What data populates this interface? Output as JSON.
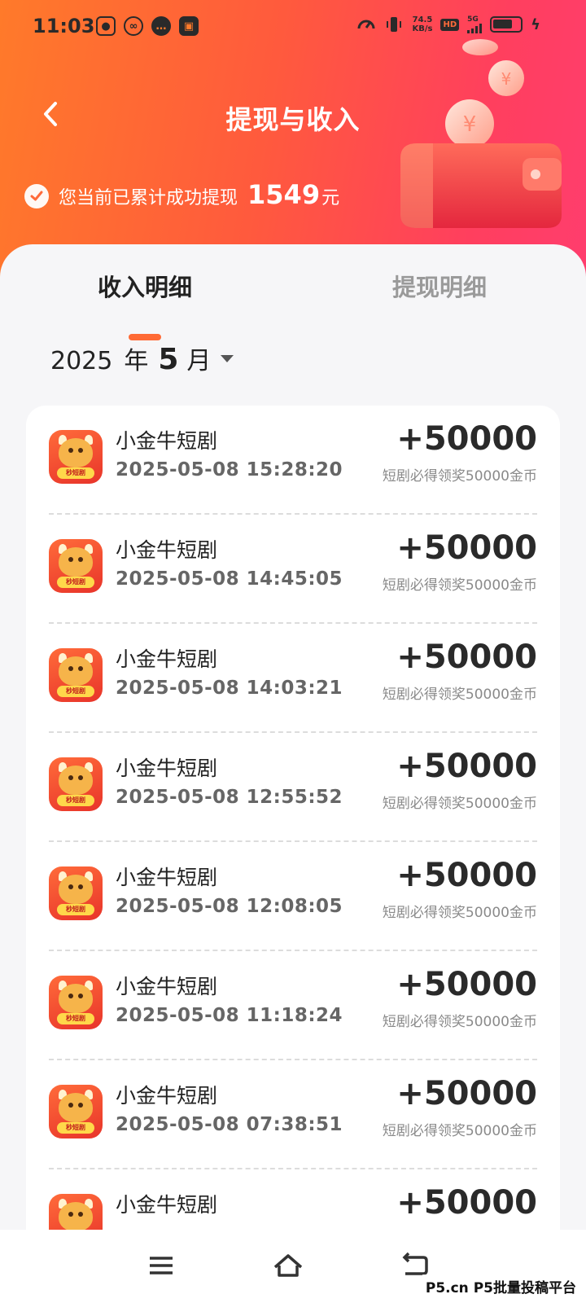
{
  "status_bar": {
    "time": "11:03",
    "net_speed_value": "74.5",
    "net_speed_unit": "KB/s",
    "hd_label": "HD",
    "network_label": "5G",
    "battery_level": 0.75,
    "icons": [
      "speedometer-icon",
      "vibrate-icon",
      "hd-icon",
      "signal-icon",
      "battery-icon",
      "charging-icon"
    ]
  },
  "header": {
    "title": "提现与收入",
    "summary_text": "您当前已累计成功提现",
    "summary_amount": "1549",
    "summary_unit": "元"
  },
  "tabs": [
    {
      "label": "收入明细",
      "active": true
    },
    {
      "label": "提现明细",
      "active": false
    }
  ],
  "date_filter": {
    "year": "2025",
    "year_unit": "年",
    "month": "5",
    "month_unit": "月"
  },
  "records": [
    {
      "name": "小金牛短剧",
      "time": "2025-05-08 15:28:20",
      "amount": "+50000",
      "desc": "短剧必得领奖50000金币"
    },
    {
      "name": "小金牛短剧",
      "time": "2025-05-08 14:45:05",
      "amount": "+50000",
      "desc": "短剧必得领奖50000金币"
    },
    {
      "name": "小金牛短剧",
      "time": "2025-05-08 14:03:21",
      "amount": "+50000",
      "desc": "短剧必得领奖50000金币"
    },
    {
      "name": "小金牛短剧",
      "time": "2025-05-08 12:55:52",
      "amount": "+50000",
      "desc": "短剧必得领奖50000金币"
    },
    {
      "name": "小金牛短剧",
      "time": "2025-05-08 12:08:05",
      "amount": "+50000",
      "desc": "短剧必得领奖50000金币"
    },
    {
      "name": "小金牛短剧",
      "time": "2025-05-08 11:18:24",
      "amount": "+50000",
      "desc": "短剧必得领奖50000金币"
    },
    {
      "name": "小金牛短剧",
      "time": "2025-05-08 07:38:51",
      "amount": "+50000",
      "desc": "短剧必得领奖50000金币"
    },
    {
      "name": "小金牛短剧",
      "time": "",
      "amount": "+50000",
      "desc": ""
    }
  ],
  "app_icon_badge": "秒短剧",
  "bottom_nav": [
    "menu-icon",
    "home-icon",
    "back-icon"
  ],
  "watermark": "P5.cn P5批量投稿平台",
  "colors": {
    "header_gradient_start": "#ff7a2a",
    "header_gradient_end": "#ff3d6e",
    "tab_accent": "#ff6a35"
  }
}
